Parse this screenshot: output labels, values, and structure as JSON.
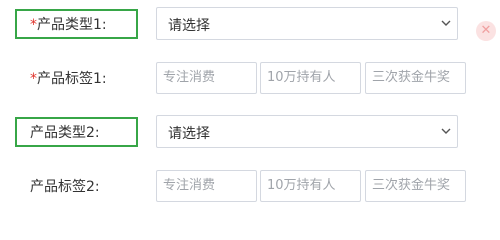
{
  "form": {
    "rows": [
      {
        "required_mark": "*",
        "label": "产品类型1:",
        "select_value": "请选择"
      },
      {
        "required_mark": "*",
        "label": "产品标签1:",
        "tags": [
          "专注消费",
          "10万持有人",
          "三次获金牛奖"
        ]
      },
      {
        "label": "产品类型2:",
        "select_value": "请选择"
      },
      {
        "label": "产品标签2:",
        "tags": [
          "专注消费",
          "10万持有人",
          "三次获金牛奖"
        ]
      }
    ]
  },
  "icons": {
    "dropdown": "chevron-down-icon",
    "close": "close-icon"
  },
  "colors": {
    "highlight": "#37a647",
    "required": "#e0342c"
  }
}
